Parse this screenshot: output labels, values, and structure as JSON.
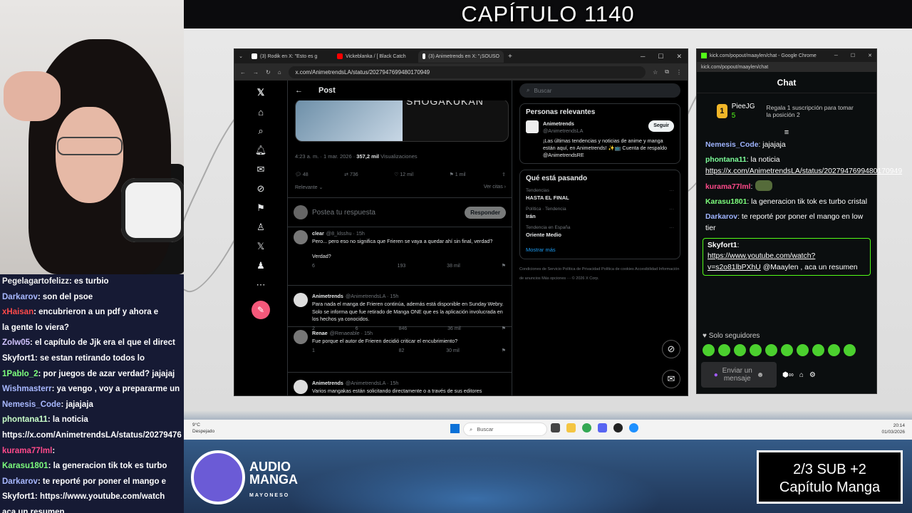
{
  "overlay": {
    "chapter_title": "CAPÍTULO 1140",
    "logo_line1": "AUDIO",
    "logo_line2": "MANGA",
    "logo_line3": "MAYONESO",
    "sub_line1": "2/3 SUB    +2",
    "sub_line2": "Capítulo Manga"
  },
  "stream_chat": [
    {
      "user": "Pegelagartofelizz",
      "text": ": es turbio",
      "color": "#f0f0f0"
    },
    {
      "user": "Darkarov",
      "text": ": son del psoe",
      "color": "#a8b8ff"
    },
    {
      "user": "xHaisan",
      "text": ": encubrieron a un pdf y ahora e",
      "color": "#ff4a4a"
    },
    {
      "user": "",
      "text": "la gente lo viera?",
      "color": "#fff"
    },
    {
      "user": "Zolw05",
      "text": ": el capítulo de Jjk era el que el direct",
      "color": "#d2c4ff"
    },
    {
      "user": "Skyfort1",
      "text": ":     se estan retirando todos lo",
      "color": "#fff"
    },
    {
      "user": "1Pablo_2",
      "text": ": por juegos de azar verdad? jajajaj",
      "color": "#7dff7d"
    },
    {
      "user": "Wishmasterr",
      "text": ": ya vengo , voy a prepararme un",
      "color": "#a8b8ff"
    },
    {
      "user": "Nemesis_Code",
      "text": ": jajajaja",
      "color": "#a8b8ff"
    },
    {
      "user": "phontana11",
      "text": ": la noticia",
      "color": "#c9ffc9"
    },
    {
      "user": "",
      "text": "https://x.com/AnimetrendsLA/status/20279476",
      "color": "#fff"
    },
    {
      "user": "kurama77lml",
      "text": ":",
      "color": "#ff4a8a"
    },
    {
      "user": "Karasu1801",
      "text": ": la generacion tik tok es turbo",
      "color": "#7dff7d"
    },
    {
      "user": "Darkarov",
      "text": ":     te reporté por poner el mango e",
      "color": "#a8b8ff"
    },
    {
      "user": "Skyfort1",
      "text": ": https://www.youtube.com/watch",
      "color": "#fff"
    },
    {
      "user": "",
      "text": "aca un resumen",
      "color": "#fff"
    }
  ],
  "browser": {
    "tabs": [
      "(3) Rodik  en X: \"Esto es g",
      "Vickeblanka / [ Black Catch",
      "(3) Animetrends en X: \"¡SOUSO"
    ],
    "url": "x.com/AnimetrendsLA/status/2027947699480170949",
    "x": {
      "header": "Post",
      "media_text": "SHOGAKUKAN",
      "meta_time": "4:23 a. m. · 1 mar. 2026 · ",
      "meta_views": "357,2 mil",
      "meta_views_label": " Visualizaciones",
      "actions": [
        "48",
        "736",
        "12 mil",
        "1 mil",
        ""
      ],
      "relevant": "Relevante",
      "see_quotes": "Ver citas",
      "reply_placeholder": "Postea tu respuesta",
      "reply_button": "Responder",
      "tweets": [
        {
          "name": "clear",
          "handle": "@8_klsshu · 15h",
          "text": "Pero... pero eso no significa que Frieren se vaya a quedar ahí sin final, verdad?\n\nVerdad?",
          "stats": [
            "6",
            "",
            "193",
            "38 mil"
          ]
        },
        {
          "name": "Animetrends",
          "handle": "@AnimetrendsLA · 15h",
          "text": "Para nada el manga de Frieren continúa, además está disponible en Sunday Webry. Solo se informa que fue retirado de Manga ONE que es la aplicación involucrada en los hechos ya conocidos.",
          "stats": [
            "2",
            "6",
            "846",
            "36 mil"
          ]
        },
        {
          "name": "Renae",
          "handle": "@Renaeable · 15h",
          "text": "Fue porque el autor de Frieren decidió criticar el encubrimiento?",
          "stats": [
            "1",
            "",
            "82",
            "30 mil"
          ]
        },
        {
          "name": "Animetrends",
          "handle": "@AnimetrendsLA · 15h",
          "text": "Varios mangakas están solicitando directamente o a través de sus editores",
          "stats": []
        }
      ],
      "search_placeholder": "Buscar",
      "relevant_people": "Personas relevantes",
      "person_name": "Animetrends",
      "person_handle": "@AnimetrendsLA",
      "follow": "Seguir",
      "person_bio": "¡Las últimas tendencias y noticias de anime y manga están aquí, en Animetrends! ✨📺 Cuenta de respaldo @AnimetrendsRE",
      "whats_happening": "Qué está pasando",
      "trends": [
        {
          "cat": "Tendencias",
          "name": "HASTA EL FINAL"
        },
        {
          "cat": "Política · Tendencia",
          "name": "Irán"
        },
        {
          "cat": "Tendencia en España",
          "name": "Oriente Medio"
        }
      ],
      "show_more": "Mostrar más",
      "footer": "Condiciones de Servicio   Política de Privacidad   Política de cookies   Accesibilidad   Información de anuncios   Más opciones ···   © 2026 X Corp."
    }
  },
  "kick": {
    "window_title": "kick.com/popout/maaylen/chat - Google Chrome",
    "url": "kick.com/popout/maaylen/chat",
    "header": "Chat",
    "top_user": "PieeJG",
    "top_rank": "1",
    "top_count": "5",
    "gift_text": "Regala 1 suscripción para tomar la posición 2",
    "messages": [
      {
        "user": "Nemesis_Code",
        "color": "#9fb4ff",
        "text": ": jajajaja"
      },
      {
        "user": "phontana11",
        "color": "#7dff9a",
        "text": ": la noticia ",
        "link": "https://x.com/AnimetrendsLA/status/2027947699480170949"
      },
      {
        "user": "kurama77lml",
        "color": "#ff4a8a",
        "text": ":"
      },
      {
        "user": "Karasu1801",
        "color": "#7dff7d",
        "text": ": la generacion tik tok es turbo cristal"
      },
      {
        "user": "Darkarov",
        "color": "#9fb4ff",
        "text": ":      te reporté por poner el mango en low tier"
      },
      {
        "user": "Skyfort1",
        "color": "#fff",
        "text": ":",
        "link": "https://www.youtube.com/watch?v=s2o81lbPXhU",
        "after": " @Maaylen , aca un resumen"
      }
    ],
    "followers_only": "Solo seguidores",
    "send_placeholder": "Enviar un mensaje"
  },
  "taskbar": {
    "weather_temp": "9°C",
    "weather_desc": "Despejado",
    "search": "Buscar",
    "time": "20:14",
    "date": "01/03/2026"
  }
}
